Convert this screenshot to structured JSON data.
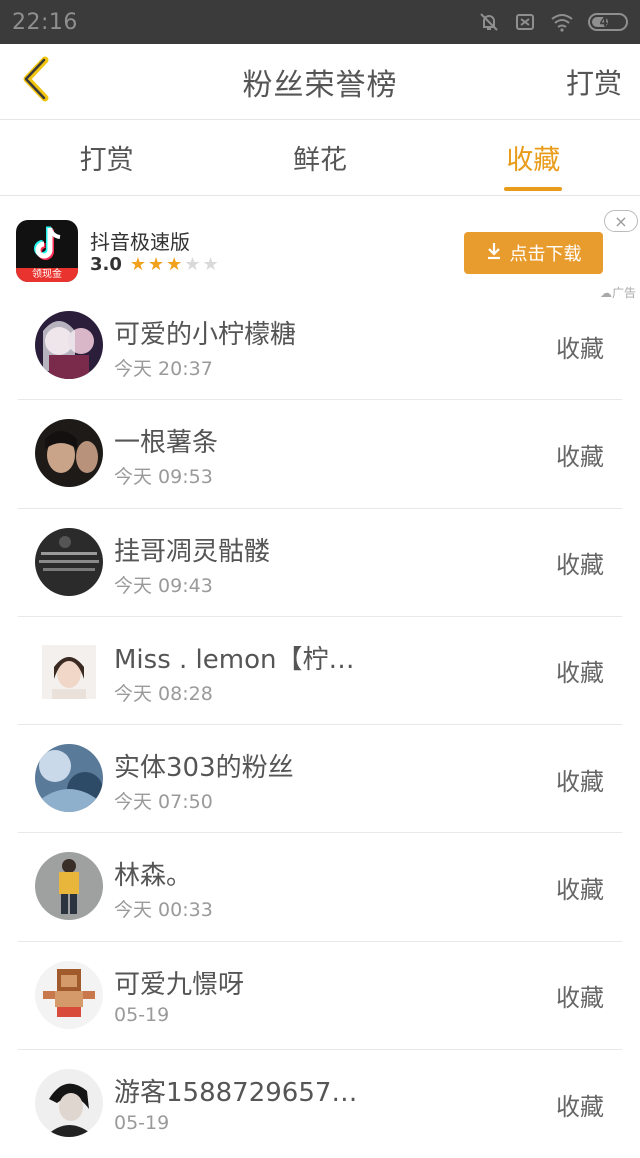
{
  "status_bar": {
    "time": "22:16",
    "battery": "41",
    "icons": [
      "bell-off-icon",
      "sim-off-icon",
      "wifi-icon",
      "battery-icon"
    ]
  },
  "header": {
    "back_icon": "chevron-left-icon",
    "title": "粉丝荣誉榜",
    "right_label": "打赏"
  },
  "tabs": [
    {
      "label": "打赏",
      "active": false
    },
    {
      "label": "鲜花",
      "active": false
    },
    {
      "label": "收藏",
      "active": true
    }
  ],
  "ad": {
    "app_name": "抖音极速版",
    "icon_badge": "领现金",
    "rating": "3.0",
    "stars_filled": 3,
    "stars_total": 5,
    "download_label": "点击下载",
    "close_label": "×",
    "tag": "广告"
  },
  "fans": [
    {
      "name": "可爱的小柠檬糖",
      "time": "今天 20:37",
      "action": "收藏"
    },
    {
      "name": "一根薯条",
      "time": "今天 09:53",
      "action": "收藏"
    },
    {
      "name": "挂哥凋灵骷髅",
      "time": "今天 09:43",
      "action": "收藏"
    },
    {
      "name": "Miss . lemon【柠…",
      "time": "今天 08:28",
      "action": "收藏"
    },
    {
      "name": "实体303的粉丝",
      "time": "今天 07:50",
      "action": "收藏"
    },
    {
      "name": "林森。",
      "time": "今天 00:33",
      "action": "收藏"
    },
    {
      "name": "可爱九憬呀",
      "time": "05-19",
      "action": "收藏"
    },
    {
      "name": "游客1588729657…",
      "time": "05-19",
      "action": "收藏"
    }
  ],
  "colors": {
    "accent": "#e99c1a",
    "status_bar": "#3b3b3b",
    "download_button": "#e99c2e"
  }
}
